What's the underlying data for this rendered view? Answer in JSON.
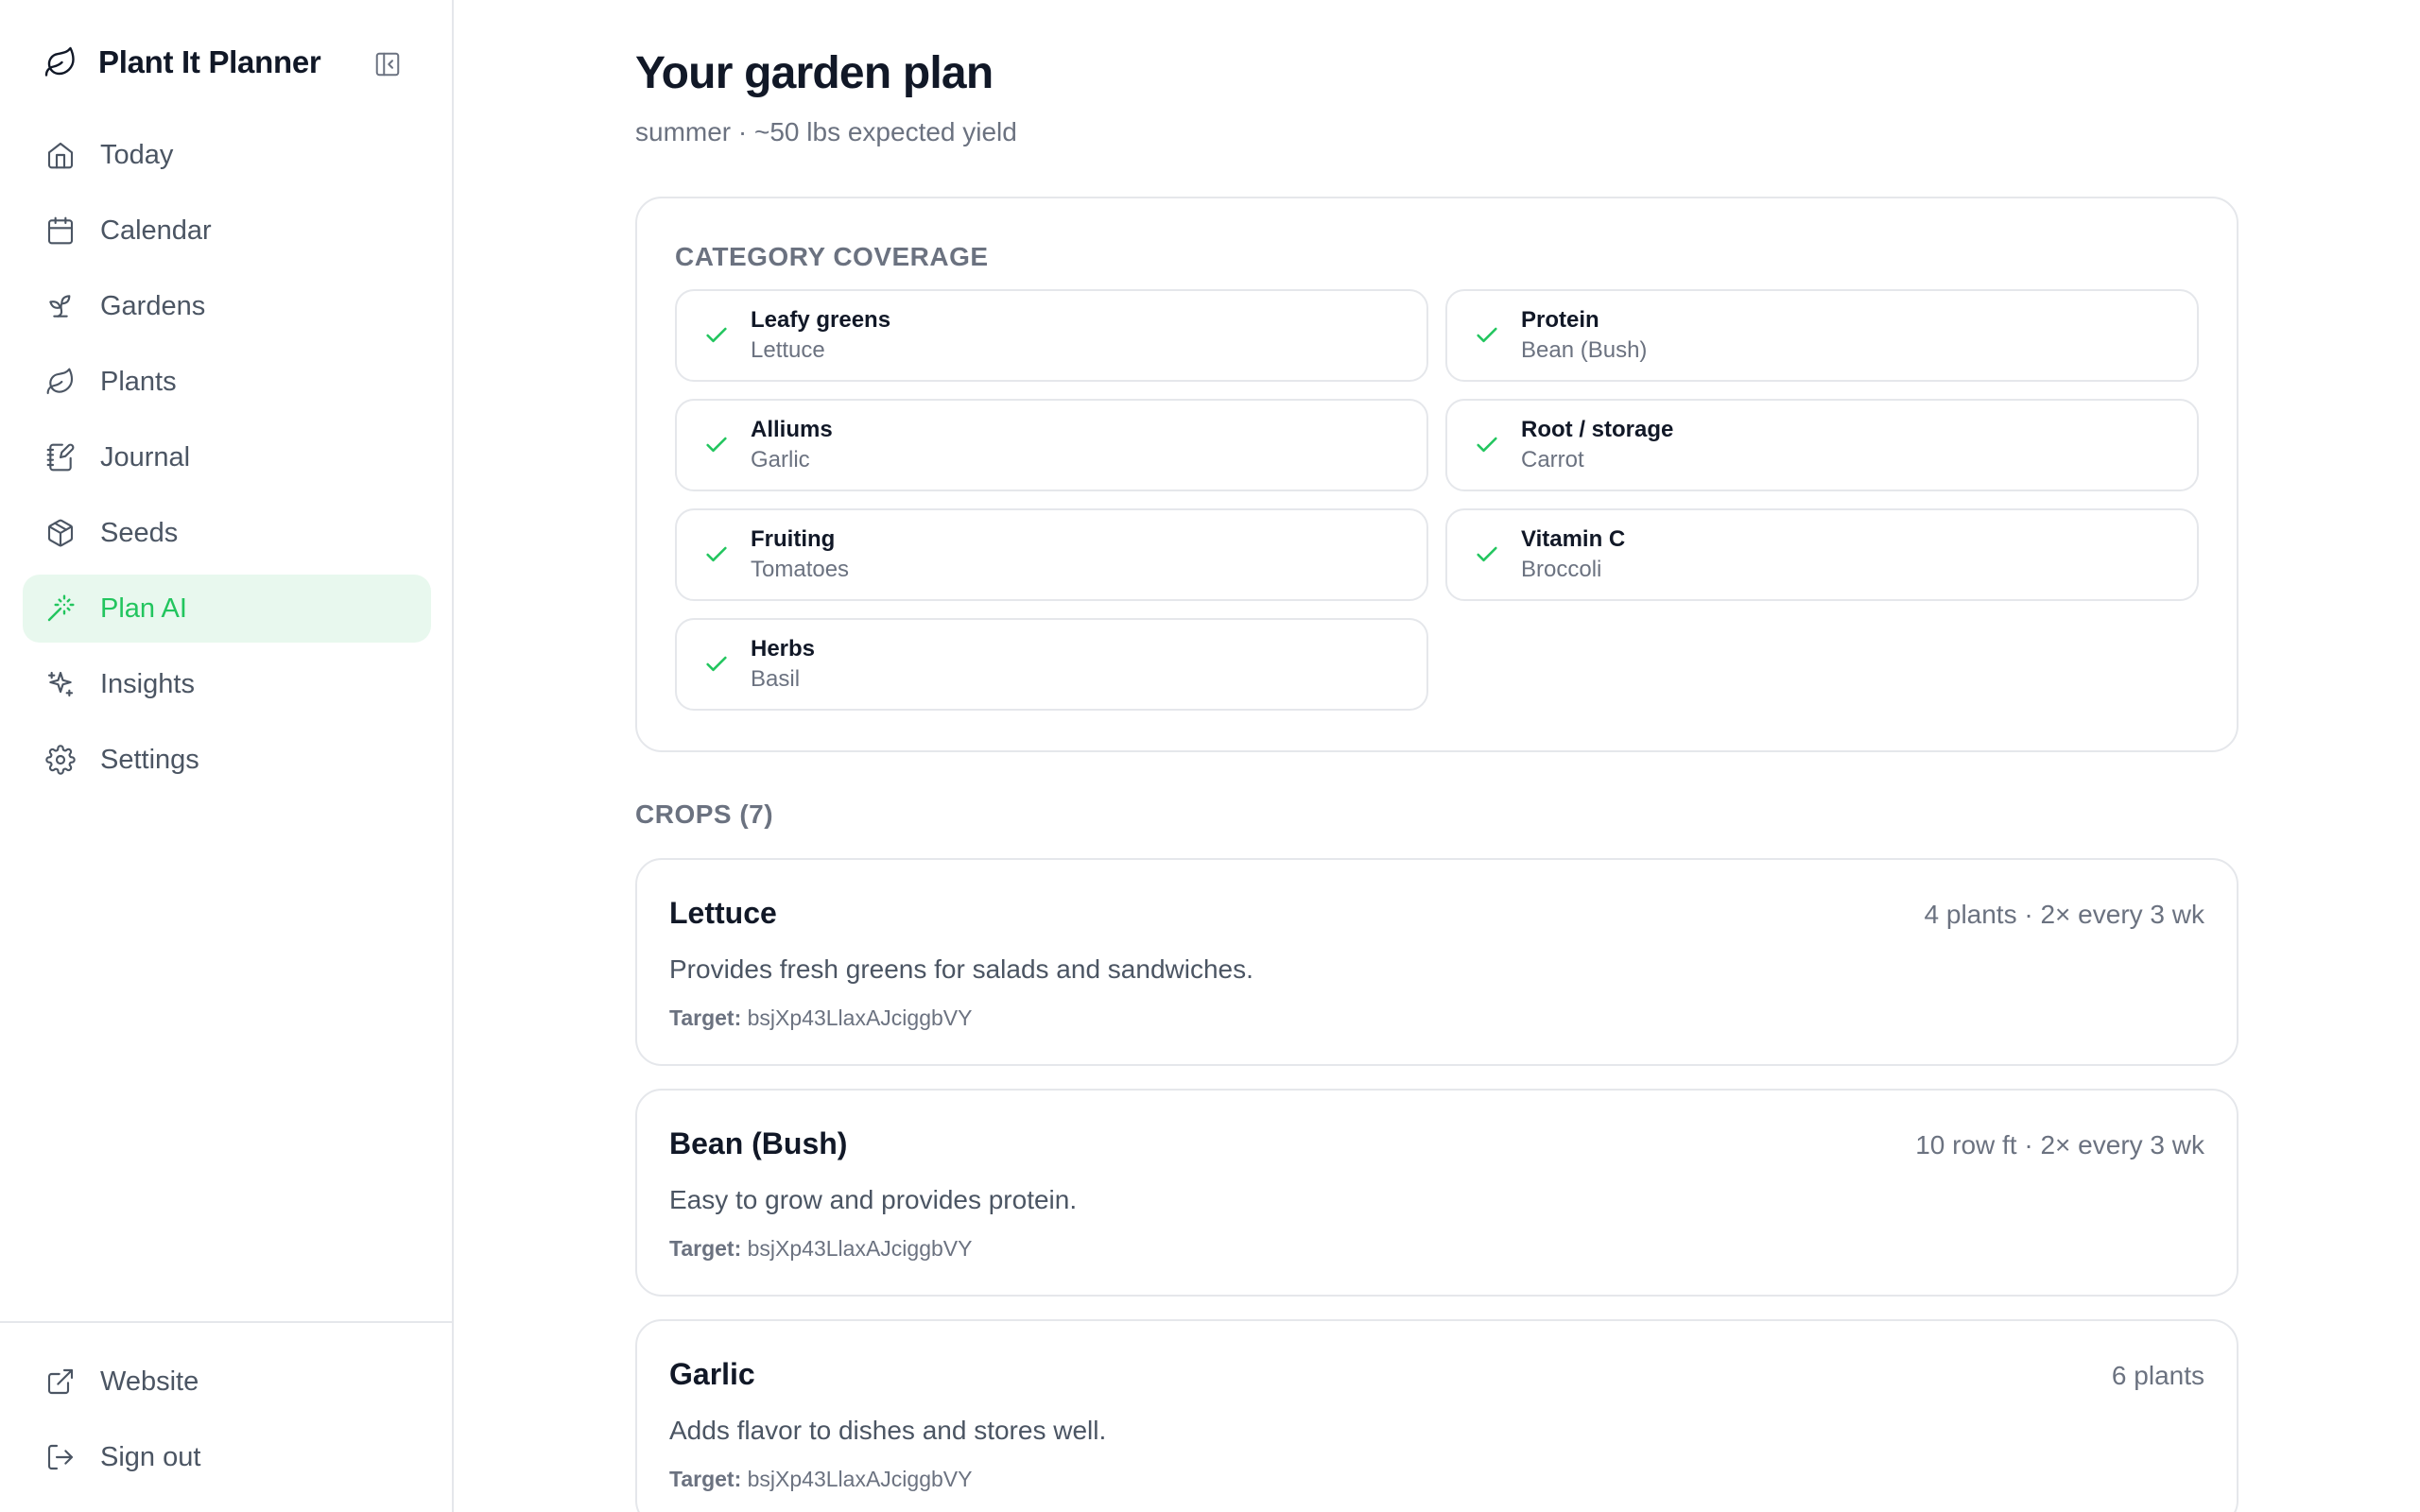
{
  "app": {
    "name": "Plant It Planner"
  },
  "sidebar": {
    "items": [
      {
        "label": "Today",
        "icon": "home-icon"
      },
      {
        "label": "Calendar",
        "icon": "calendar-icon"
      },
      {
        "label": "Gardens",
        "icon": "sprout-icon"
      },
      {
        "label": "Plants",
        "icon": "leaf-icon"
      },
      {
        "label": "Journal",
        "icon": "notebook-pen-icon"
      },
      {
        "label": "Seeds",
        "icon": "package-icon"
      },
      {
        "label": "Plan AI",
        "icon": "wand-sparkles-icon",
        "active": true
      },
      {
        "label": "Insights",
        "icon": "sparkles-icon"
      },
      {
        "label": "Settings",
        "icon": "gear-icon"
      }
    ],
    "bottom": [
      {
        "label": "Website",
        "icon": "external-link-icon"
      },
      {
        "label": "Sign out",
        "icon": "log-out-icon"
      }
    ]
  },
  "page": {
    "title": "Your garden plan",
    "subtitle": "summer · ~50 lbs expected yield"
  },
  "coverage": {
    "label": "CATEGORY COVERAGE",
    "items": [
      {
        "name": "Leafy greens",
        "crop": "Lettuce"
      },
      {
        "name": "Protein",
        "crop": "Bean (Bush)"
      },
      {
        "name": "Alliums",
        "crop": "Garlic"
      },
      {
        "name": "Root / storage",
        "crop": "Carrot"
      },
      {
        "name": "Fruiting",
        "crop": "Tomatoes"
      },
      {
        "name": "Vitamin C",
        "crop": "Broccoli"
      },
      {
        "name": "Herbs",
        "crop": "Basil"
      }
    ]
  },
  "crops": {
    "label": "CROPS (7)",
    "target_label": "Target:",
    "items": [
      {
        "name": "Lettuce",
        "meta": "4 plants · 2× every 3 wk",
        "description": "Provides fresh greens for salads and sandwiches.",
        "target": "bsjXp43LlaxAJciggbVY"
      },
      {
        "name": "Bean (Bush)",
        "meta": "10 row ft · 2× every 3 wk",
        "description": "Easy to grow and provides protein.",
        "target": "bsjXp43LlaxAJciggbVY"
      },
      {
        "name": "Garlic",
        "meta": "6 plants",
        "description": "Adds flavor to dishes and stores well.",
        "target": "bsjXp43LlaxAJciggbVY"
      }
    ]
  },
  "colors": {
    "accent": "#22c55e",
    "active_bg": "#e8f8ee",
    "border": "#e5e7eb",
    "muted_text": "#6b7280"
  }
}
